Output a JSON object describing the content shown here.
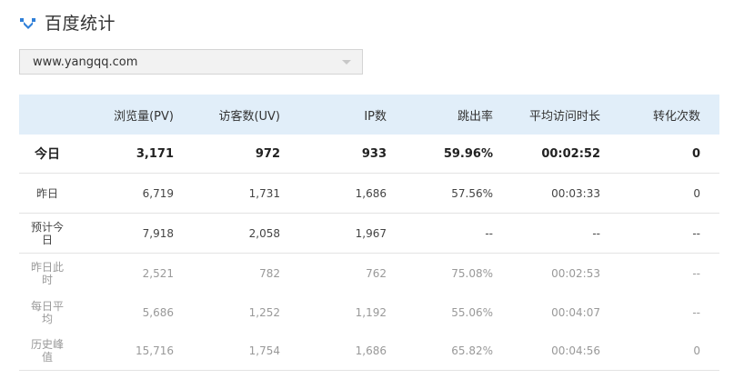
{
  "header": {
    "title": "百度统计",
    "icon": "baidu-tongji-logo-icon"
  },
  "site_selector": {
    "value": "www.yangqq.com",
    "icon": "chevron-down-icon"
  },
  "table": {
    "columns": [
      "",
      "浏览量(PV)",
      "访客数(UV)",
      "IP数",
      "跳出率",
      "平均访问时长",
      "转化次数"
    ],
    "rows": [
      {
        "label": "今日",
        "values": [
          "3,171",
          "972",
          "933",
          "59.96%",
          "00:02:52",
          "0"
        ]
      },
      {
        "label": "昨日",
        "values": [
          "6,719",
          "1,731",
          "1,686",
          "57.56%",
          "00:03:33",
          "0"
        ]
      },
      {
        "label": "预计今日",
        "values": [
          "7,918",
          "2,058",
          "1,967",
          "--",
          "--",
          "--"
        ]
      },
      {
        "label": "昨日此时",
        "values": [
          "2,521",
          "782",
          "762",
          "75.08%",
          "00:02:53",
          "--"
        ]
      },
      {
        "label": "每日平均",
        "values": [
          "5,686",
          "1,252",
          "1,192",
          "55.06%",
          "00:04:07",
          "--"
        ]
      },
      {
        "label": "历史峰值",
        "values": [
          "15,716",
          "1,754",
          "1,686",
          "65.82%",
          "00:04:56",
          "0"
        ]
      }
    ]
  },
  "colors": {
    "header_bg": "#e1eef9",
    "logo_blue": "#2f7fd8",
    "muted_text": "#999999"
  }
}
